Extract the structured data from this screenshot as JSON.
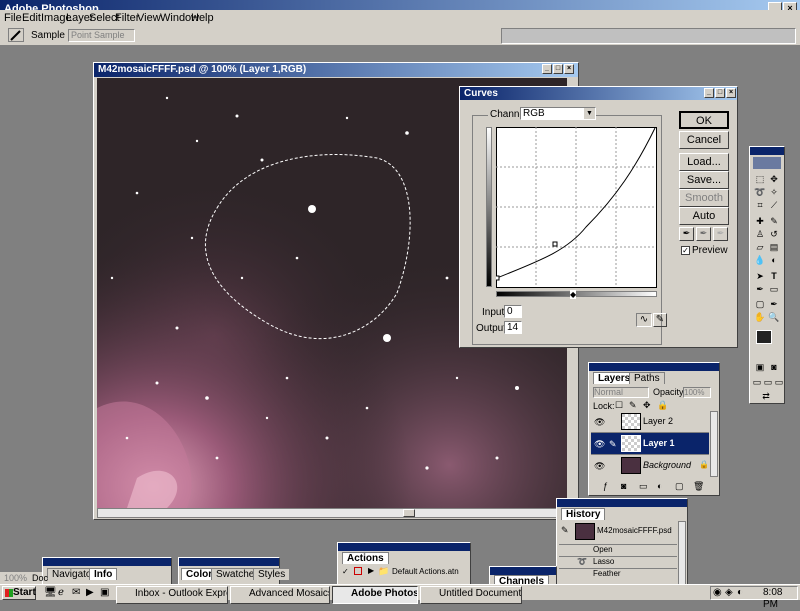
{
  "app": {
    "title": "Adobe Photoshop"
  },
  "menu": [
    "File",
    "Edit",
    "Image",
    "Layer",
    "Select",
    "Filter",
    "View",
    "Window",
    "Help"
  ],
  "options_bar": {
    "sample_size_label": "Sample Size:",
    "sample_size_value": "Point Sample"
  },
  "document": {
    "title": "M42mosaicFFFF.psd @ 100% (Layer 1,RGB)",
    "zoom": "100%",
    "status": "Doc"
  },
  "curves": {
    "title": "Curves",
    "channel_label": "Channel:",
    "channel_value": "RGB",
    "buttons": {
      "ok": "OK",
      "cancel": "Cancel",
      "load": "Load...",
      "save": "Save...",
      "smooth": "Smooth",
      "auto": "Auto"
    },
    "preview_label": "Preview",
    "preview_checked": true,
    "input_label": "Input:",
    "input_value": "0",
    "output_label": "Output:",
    "output_value": "14"
  },
  "layers": {
    "tabs": [
      "Layers",
      "Paths"
    ],
    "blend_mode": "Normal",
    "opacity_label": "Opacity:",
    "opacity_value": "100%",
    "lock_label": "Lock:",
    "items": [
      {
        "name": "Layer 2",
        "selected": false
      },
      {
        "name": "Layer 1",
        "selected": true
      },
      {
        "name": "Background",
        "selected": false
      }
    ]
  },
  "history": {
    "title": "History",
    "snapshot": "M42mosaicFFFF.psd",
    "items": [
      "Open",
      "Lasso",
      "Feather"
    ]
  },
  "actions": {
    "tab": "Actions",
    "item": "Default Actions.atn"
  },
  "channels": {
    "tab": "Channels"
  },
  "navigator": {
    "tabs": [
      "Navigator",
      "Info"
    ]
  },
  "color": {
    "tabs": [
      "Color",
      "Swatches",
      "Styles"
    ]
  },
  "taskbar": {
    "start": "Start",
    "tasks": [
      "Inbox - Outlook Express pr...",
      "Advanced Mosaics.doc - ...",
      "Adobe Photoshop",
      "Untitled Document - Micro..."
    ],
    "clock": "8:08 PM"
  }
}
